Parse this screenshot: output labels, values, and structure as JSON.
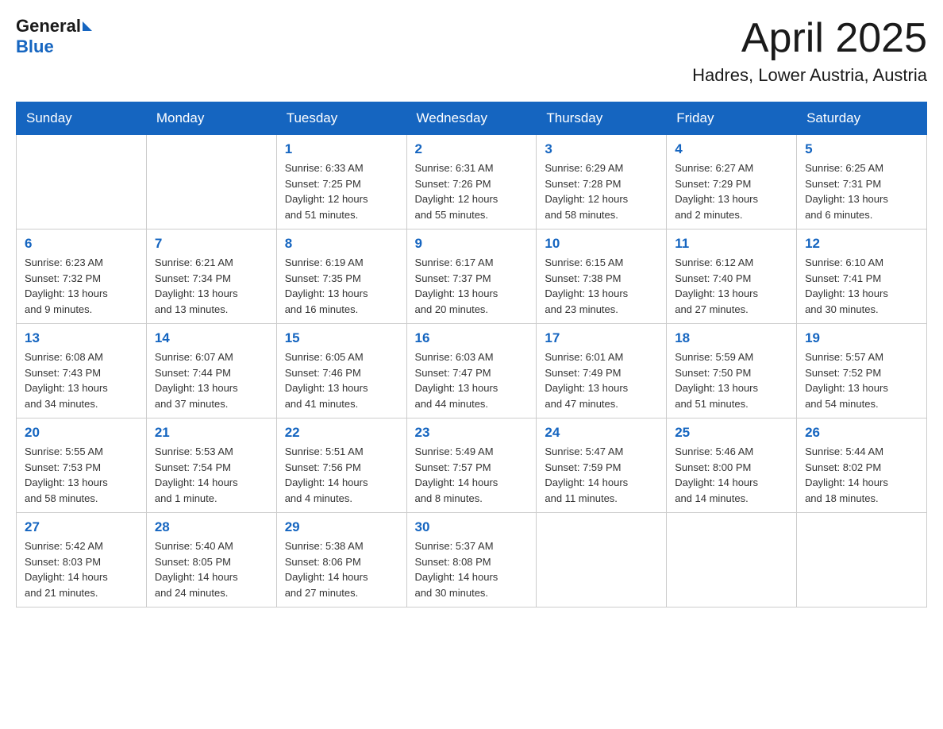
{
  "header": {
    "logo_general": "General",
    "logo_blue": "Blue",
    "month_title": "April 2025",
    "location": "Hadres, Lower Austria, Austria"
  },
  "weekdays": [
    "Sunday",
    "Monday",
    "Tuesday",
    "Wednesday",
    "Thursday",
    "Friday",
    "Saturday"
  ],
  "weeks": [
    [
      {
        "day": "",
        "info": ""
      },
      {
        "day": "",
        "info": ""
      },
      {
        "day": "1",
        "info": "Sunrise: 6:33 AM\nSunset: 7:25 PM\nDaylight: 12 hours\nand 51 minutes."
      },
      {
        "day": "2",
        "info": "Sunrise: 6:31 AM\nSunset: 7:26 PM\nDaylight: 12 hours\nand 55 minutes."
      },
      {
        "day": "3",
        "info": "Sunrise: 6:29 AM\nSunset: 7:28 PM\nDaylight: 12 hours\nand 58 minutes."
      },
      {
        "day": "4",
        "info": "Sunrise: 6:27 AM\nSunset: 7:29 PM\nDaylight: 13 hours\nand 2 minutes."
      },
      {
        "day": "5",
        "info": "Sunrise: 6:25 AM\nSunset: 7:31 PM\nDaylight: 13 hours\nand 6 minutes."
      }
    ],
    [
      {
        "day": "6",
        "info": "Sunrise: 6:23 AM\nSunset: 7:32 PM\nDaylight: 13 hours\nand 9 minutes."
      },
      {
        "day": "7",
        "info": "Sunrise: 6:21 AM\nSunset: 7:34 PM\nDaylight: 13 hours\nand 13 minutes."
      },
      {
        "day": "8",
        "info": "Sunrise: 6:19 AM\nSunset: 7:35 PM\nDaylight: 13 hours\nand 16 minutes."
      },
      {
        "day": "9",
        "info": "Sunrise: 6:17 AM\nSunset: 7:37 PM\nDaylight: 13 hours\nand 20 minutes."
      },
      {
        "day": "10",
        "info": "Sunrise: 6:15 AM\nSunset: 7:38 PM\nDaylight: 13 hours\nand 23 minutes."
      },
      {
        "day": "11",
        "info": "Sunrise: 6:12 AM\nSunset: 7:40 PM\nDaylight: 13 hours\nand 27 minutes."
      },
      {
        "day": "12",
        "info": "Sunrise: 6:10 AM\nSunset: 7:41 PM\nDaylight: 13 hours\nand 30 minutes."
      }
    ],
    [
      {
        "day": "13",
        "info": "Sunrise: 6:08 AM\nSunset: 7:43 PM\nDaylight: 13 hours\nand 34 minutes."
      },
      {
        "day": "14",
        "info": "Sunrise: 6:07 AM\nSunset: 7:44 PM\nDaylight: 13 hours\nand 37 minutes."
      },
      {
        "day": "15",
        "info": "Sunrise: 6:05 AM\nSunset: 7:46 PM\nDaylight: 13 hours\nand 41 minutes."
      },
      {
        "day": "16",
        "info": "Sunrise: 6:03 AM\nSunset: 7:47 PM\nDaylight: 13 hours\nand 44 minutes."
      },
      {
        "day": "17",
        "info": "Sunrise: 6:01 AM\nSunset: 7:49 PM\nDaylight: 13 hours\nand 47 minutes."
      },
      {
        "day": "18",
        "info": "Sunrise: 5:59 AM\nSunset: 7:50 PM\nDaylight: 13 hours\nand 51 minutes."
      },
      {
        "day": "19",
        "info": "Sunrise: 5:57 AM\nSunset: 7:52 PM\nDaylight: 13 hours\nand 54 minutes."
      }
    ],
    [
      {
        "day": "20",
        "info": "Sunrise: 5:55 AM\nSunset: 7:53 PM\nDaylight: 13 hours\nand 58 minutes."
      },
      {
        "day": "21",
        "info": "Sunrise: 5:53 AM\nSunset: 7:54 PM\nDaylight: 14 hours\nand 1 minute."
      },
      {
        "day": "22",
        "info": "Sunrise: 5:51 AM\nSunset: 7:56 PM\nDaylight: 14 hours\nand 4 minutes."
      },
      {
        "day": "23",
        "info": "Sunrise: 5:49 AM\nSunset: 7:57 PM\nDaylight: 14 hours\nand 8 minutes."
      },
      {
        "day": "24",
        "info": "Sunrise: 5:47 AM\nSunset: 7:59 PM\nDaylight: 14 hours\nand 11 minutes."
      },
      {
        "day": "25",
        "info": "Sunrise: 5:46 AM\nSunset: 8:00 PM\nDaylight: 14 hours\nand 14 minutes."
      },
      {
        "day": "26",
        "info": "Sunrise: 5:44 AM\nSunset: 8:02 PM\nDaylight: 14 hours\nand 18 minutes."
      }
    ],
    [
      {
        "day": "27",
        "info": "Sunrise: 5:42 AM\nSunset: 8:03 PM\nDaylight: 14 hours\nand 21 minutes."
      },
      {
        "day": "28",
        "info": "Sunrise: 5:40 AM\nSunset: 8:05 PM\nDaylight: 14 hours\nand 24 minutes."
      },
      {
        "day": "29",
        "info": "Sunrise: 5:38 AM\nSunset: 8:06 PM\nDaylight: 14 hours\nand 27 minutes."
      },
      {
        "day": "30",
        "info": "Sunrise: 5:37 AM\nSunset: 8:08 PM\nDaylight: 14 hours\nand 30 minutes."
      },
      {
        "day": "",
        "info": ""
      },
      {
        "day": "",
        "info": ""
      },
      {
        "day": "",
        "info": ""
      }
    ]
  ]
}
